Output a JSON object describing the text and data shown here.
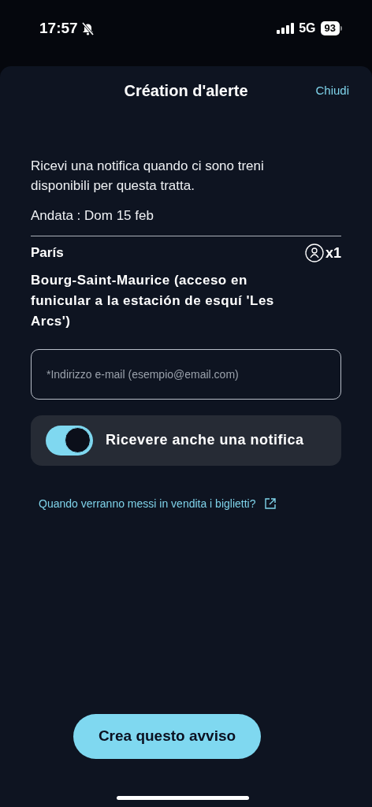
{
  "status_bar": {
    "time": "17:57",
    "silent": true,
    "network": "5G",
    "battery": "93"
  },
  "sheet": {
    "title": "Création d'alerte",
    "close": "Chiudi"
  },
  "description": "Ricevi una notifica quando ci sono treni disponibili per questa tratta.",
  "outbound": "Andata : Dom 15 feb",
  "route": {
    "origin": "París",
    "destination": "Bourg-Saint-Maurice (acceso en funicular a la estación de esquí 'Les Arcs')",
    "passengers": "x1"
  },
  "email_field": {
    "placeholder": "*Indirizzo e-mail (esempio@email.com)"
  },
  "notification_toggle": {
    "label": "Ricevere anche una notifica",
    "on": true
  },
  "info_link": "Quando verranno messi in vendita i biglietti?",
  "submit_button": "Crea questo avviso"
}
